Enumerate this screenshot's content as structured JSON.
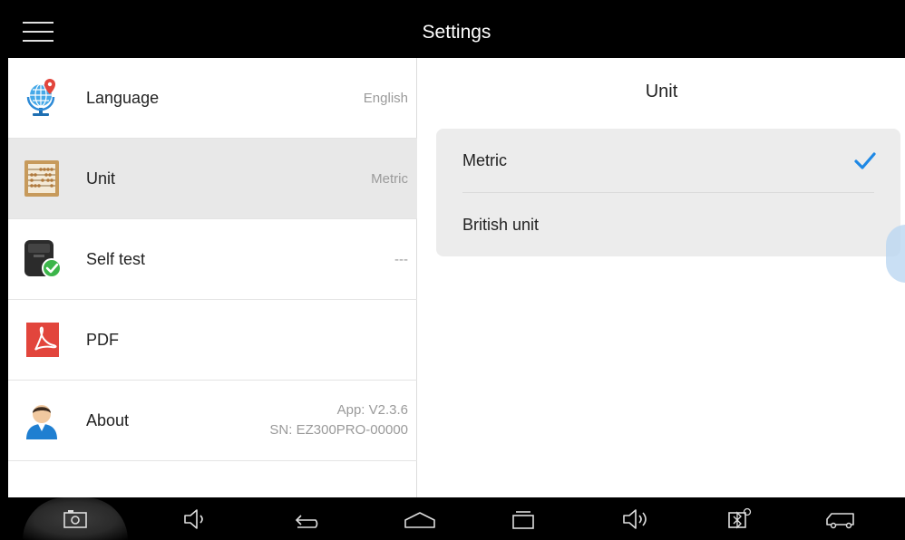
{
  "header": {
    "title": "Settings",
    "menu_icon": "hamburger-menu-icon"
  },
  "settings_list": [
    {
      "label": "Language",
      "value": "English",
      "icon": "globe-location-icon"
    },
    {
      "label": "Unit",
      "value": "Metric",
      "icon": "abacus-icon",
      "selected": true
    },
    {
      "label": "Self test",
      "value": "---",
      "icon": "device-check-icon"
    },
    {
      "label": "PDF",
      "value": "",
      "icon": "pdf-icon"
    },
    {
      "label": "About",
      "value_line1": "App: V2.3.6",
      "value_line2": "SN: EZ300PRO-00000",
      "icon": "user-avatar-icon"
    }
  ],
  "unit_panel": {
    "title": "Unit",
    "options": [
      {
        "label": "Metric",
        "checked": true
      },
      {
        "label": "British unit",
        "checked": false
      }
    ]
  },
  "navbar": {
    "buttons": [
      "screenshot-icon",
      "volume-down-icon",
      "back-icon",
      "home-icon",
      "recent-apps-icon",
      "volume-up-icon",
      "bluetooth-vci-icon",
      "vehicle-icon"
    ]
  },
  "colors": {
    "accent": "#1e88e5",
    "bars": "#000000",
    "selected_row": "#e8e8e8",
    "card": "#ececec"
  }
}
